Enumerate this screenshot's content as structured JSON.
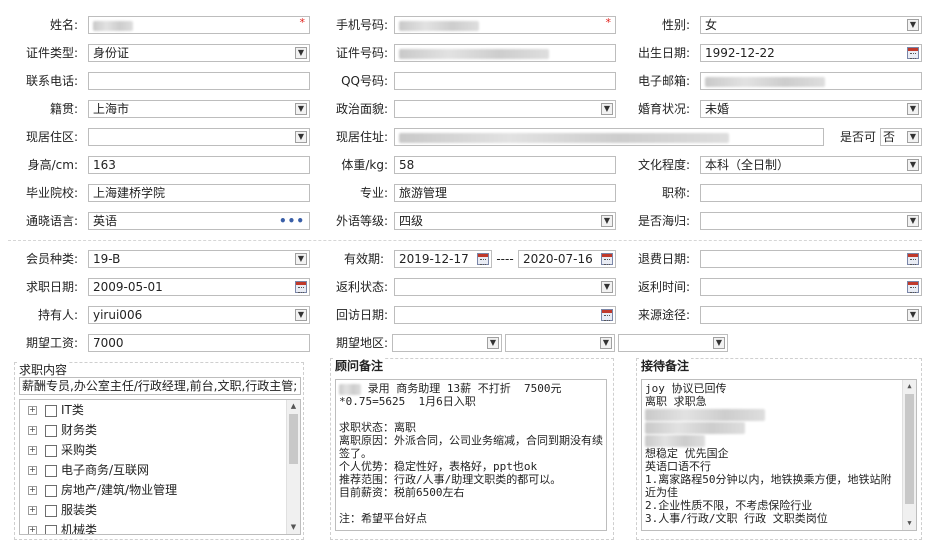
{
  "form": {
    "name": {
      "label": "姓名:"
    },
    "mobile": {
      "label": "手机号码:"
    },
    "gender": {
      "label": "性别:",
      "value": "女"
    },
    "id_type": {
      "label": "证件类型:",
      "value": "身份证"
    },
    "id_number": {
      "label": "证件号码:"
    },
    "birthdate": {
      "label": "出生日期:",
      "value": "1992-12-22"
    },
    "phone": {
      "label": "联系电话:"
    },
    "qq": {
      "label": "QQ号码:"
    },
    "email": {
      "label": "电子邮箱:"
    },
    "native_place": {
      "label": "籍贯:",
      "value": "上海市"
    },
    "political": {
      "label": "政治面貌:"
    },
    "marital": {
      "label": "婚育状况:",
      "value": "未婚"
    },
    "district": {
      "label": "现居住区:"
    },
    "address": {
      "label": "现居住址:"
    },
    "confirm": {
      "label": "是否可",
      "value": "否"
    },
    "height": {
      "label": "身高/cm:",
      "value": "163"
    },
    "weight": {
      "label": "体重/kg:",
      "value": "58"
    },
    "education": {
      "label": "文化程度:",
      "value": "本科（全日制）"
    },
    "school": {
      "label": "毕业院校:",
      "value": "上海建桥学院"
    },
    "major": {
      "label": "专业:",
      "value": "旅游管理"
    },
    "title": {
      "label": "职称:"
    },
    "language": {
      "label": "通晓语言:",
      "value": "英语"
    },
    "lang_level": {
      "label": "外语等级:",
      "value": "四级"
    },
    "returnee": {
      "label": "是否海归:"
    },
    "member_type": {
      "label": "会员种类:",
      "value": "19-B"
    },
    "valid": {
      "label": "有效期:",
      "from": "2019-12-17",
      "dash": "----",
      "to": "2020-07-16"
    },
    "refund_date": {
      "label": "退费日期:"
    },
    "job_date": {
      "label": "求职日期:",
      "value": "2009-05-01"
    },
    "rebate_status": {
      "label": "返利状态:"
    },
    "rebate_time": {
      "label": "返利时间:"
    },
    "holder": {
      "label": "持有人:",
      "value": "yirui006"
    },
    "visit_date": {
      "label": "回访日期:"
    },
    "source": {
      "label": "来源途径:"
    },
    "salary": {
      "label": "期望工资:",
      "value": "7000"
    },
    "area": {
      "label": "期望地区:"
    }
  },
  "job_panel": {
    "title": "求职内容",
    "summary": "薪酬专员,办公室主任/行政经理,前台,文职,行政主管;",
    "tree": [
      "IT类",
      "财务类",
      "采购类",
      "电子商务/互联网",
      "房地产/建筑/物业管理",
      "服装类",
      "机械类"
    ]
  },
  "advisor_panel": {
    "title": "顾问备注",
    "line1": "录用 商务助理 13薪 不打折  7500元",
    "rest": "*0.75=5625  1月6日入职\n\n求职状态：离职\n离职原因：外派合同，公司业务缩减，合同到期没有续签了。\n个人优势：稳定性好，表格好，ppt也ok\n推荐范围：行政/人事/助理文职类的都可以。\n目前薪资：税前6500左右\n\n注：希望平台好点"
  },
  "reception_panel": {
    "title": "接待备注",
    "top": "joy 协议已回传\n离职 求职急",
    "bottom": "想稳定 优先国企\n英语口语不行\n1.离家路程50分钟以内，地铁换乘方便，地铁站附近为佳\n2.企业性质不限，不考虑保险行业\n3.人事/行政/文职 行政 文职类岗位"
  }
}
